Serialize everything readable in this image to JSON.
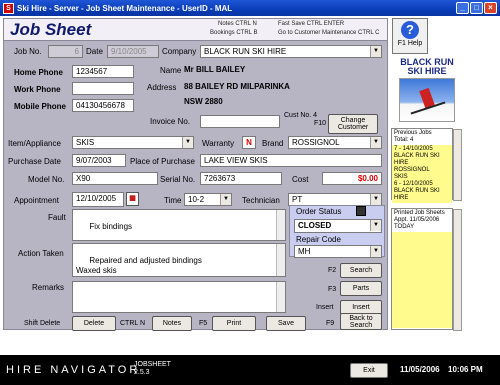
{
  "window": {
    "title": "Ski Hire - Server - Job Sheet Maintenance - UserID - MAL"
  },
  "header": {
    "title": "Job Sheet",
    "hint1": "Notes CTRL N",
    "hint2": "Bookings CTRL B",
    "hint3": "Fast Save CTRL ENTER",
    "hint4": "Go to Customer Maintenance CTRL C"
  },
  "form": {
    "job_no_label": "Job No.",
    "job_no": "6",
    "date_label": "Date",
    "date": "9/10/2005",
    "company_label": "Company",
    "company": "BLACK RUN SKI HIRE",
    "home_phone_label": "Home Phone",
    "home_phone": "1234567",
    "work_phone_label": "Work Phone",
    "work_phone": "",
    "mobile_phone_label": "Mobile Phone",
    "mobile_phone": "04130456678",
    "name_label": "Name",
    "name": "Mr BILL BAILEY",
    "address_label": "Address",
    "address1": "88 BAILEY RD  MILPARINKA",
    "address2": "NSW 2880",
    "invoice_label": "Invoice No.",
    "invoice": "",
    "cust_no_label": "Cust No. 4",
    "f10_label": "F10",
    "change_customer_label": "Change Customer",
    "item_label": "Item/Appliance",
    "item": "SKIS",
    "warranty_label": "Warranty",
    "warranty": "N",
    "brand_label": "Brand",
    "brand": "ROSSIGNOL",
    "purchase_date_label": "Purchase Date",
    "purchase_date": "9/07/2003",
    "place_label": "Place of Purchase",
    "place": "LAKE VIEW SKIS",
    "model_label": "Model No.",
    "model": "X90",
    "serial_label": "Serial No.",
    "serial": "7263673",
    "cost_label": "Cost",
    "cost": "$0.00",
    "appointment_label": "Appointment",
    "appointment": "12/10/2005",
    "time_label": "Time",
    "time": "10-2",
    "technician_label": "Technician",
    "technician": "PT",
    "fault_label": "Fault",
    "fault": "Fix bindings",
    "order_status_label": "Order Status",
    "order_status": "CLOSED",
    "repair_code_label": "Repair Code",
    "repair_code": "MH",
    "action_label": "Action Taken",
    "action": "Repaired and adjusted bindings\nWaxed skis",
    "remarks_label": "Remarks",
    "remarks": ""
  },
  "right_buttons": {
    "f2_label": "F2",
    "search_label": "Search",
    "f3_label": "F3",
    "parts_label": "Parts",
    "insert_key_label": "Insert",
    "insert_label": "Insert",
    "f9_label": "F9",
    "back_label": "Back to Search"
  },
  "bottom_buttons": {
    "shift_delete_label": "Shift Delete",
    "delete_label": "Delete",
    "ctrl_n_label": "CTRL N",
    "notes_label": "Notes",
    "f5_label": "F5",
    "print_label": "Print",
    "save_label": "Save"
  },
  "side": {
    "help_label": "F1 Help",
    "brand_line1": "BLACK RUN",
    "brand_line2": "SKI HIRE",
    "prev_jobs_title": "Previous Jobs",
    "prev_jobs_total": "Total: 4",
    "prev_jobs": [
      "7 - 14/10/2005",
      "BLACK RUN SKI",
      "HIRE",
      "ROSSIGNOL",
      "SKIS",
      "6 - 12/10/2005",
      "BLACK RUN SKI",
      "HIRE"
    ],
    "printed_title": "Printed Job Sheets",
    "printed_sub": "Appt. 11/05/2006",
    "printed_today": "TODAY"
  },
  "footer": {
    "logo": "HIRE NAVIGATOR",
    "module": "JOBSHEET",
    "version": "2.5.3",
    "exit_label": "Exit",
    "date": "11/05/2006",
    "time": "10:06 PM"
  },
  "colors": {
    "title_bar": "#0a3db8",
    "form_bg": "#b7b4c4",
    "cost_red": "#dd0000",
    "brand_blue": "#1b2a86",
    "list_yellow": "#fffb8c"
  }
}
